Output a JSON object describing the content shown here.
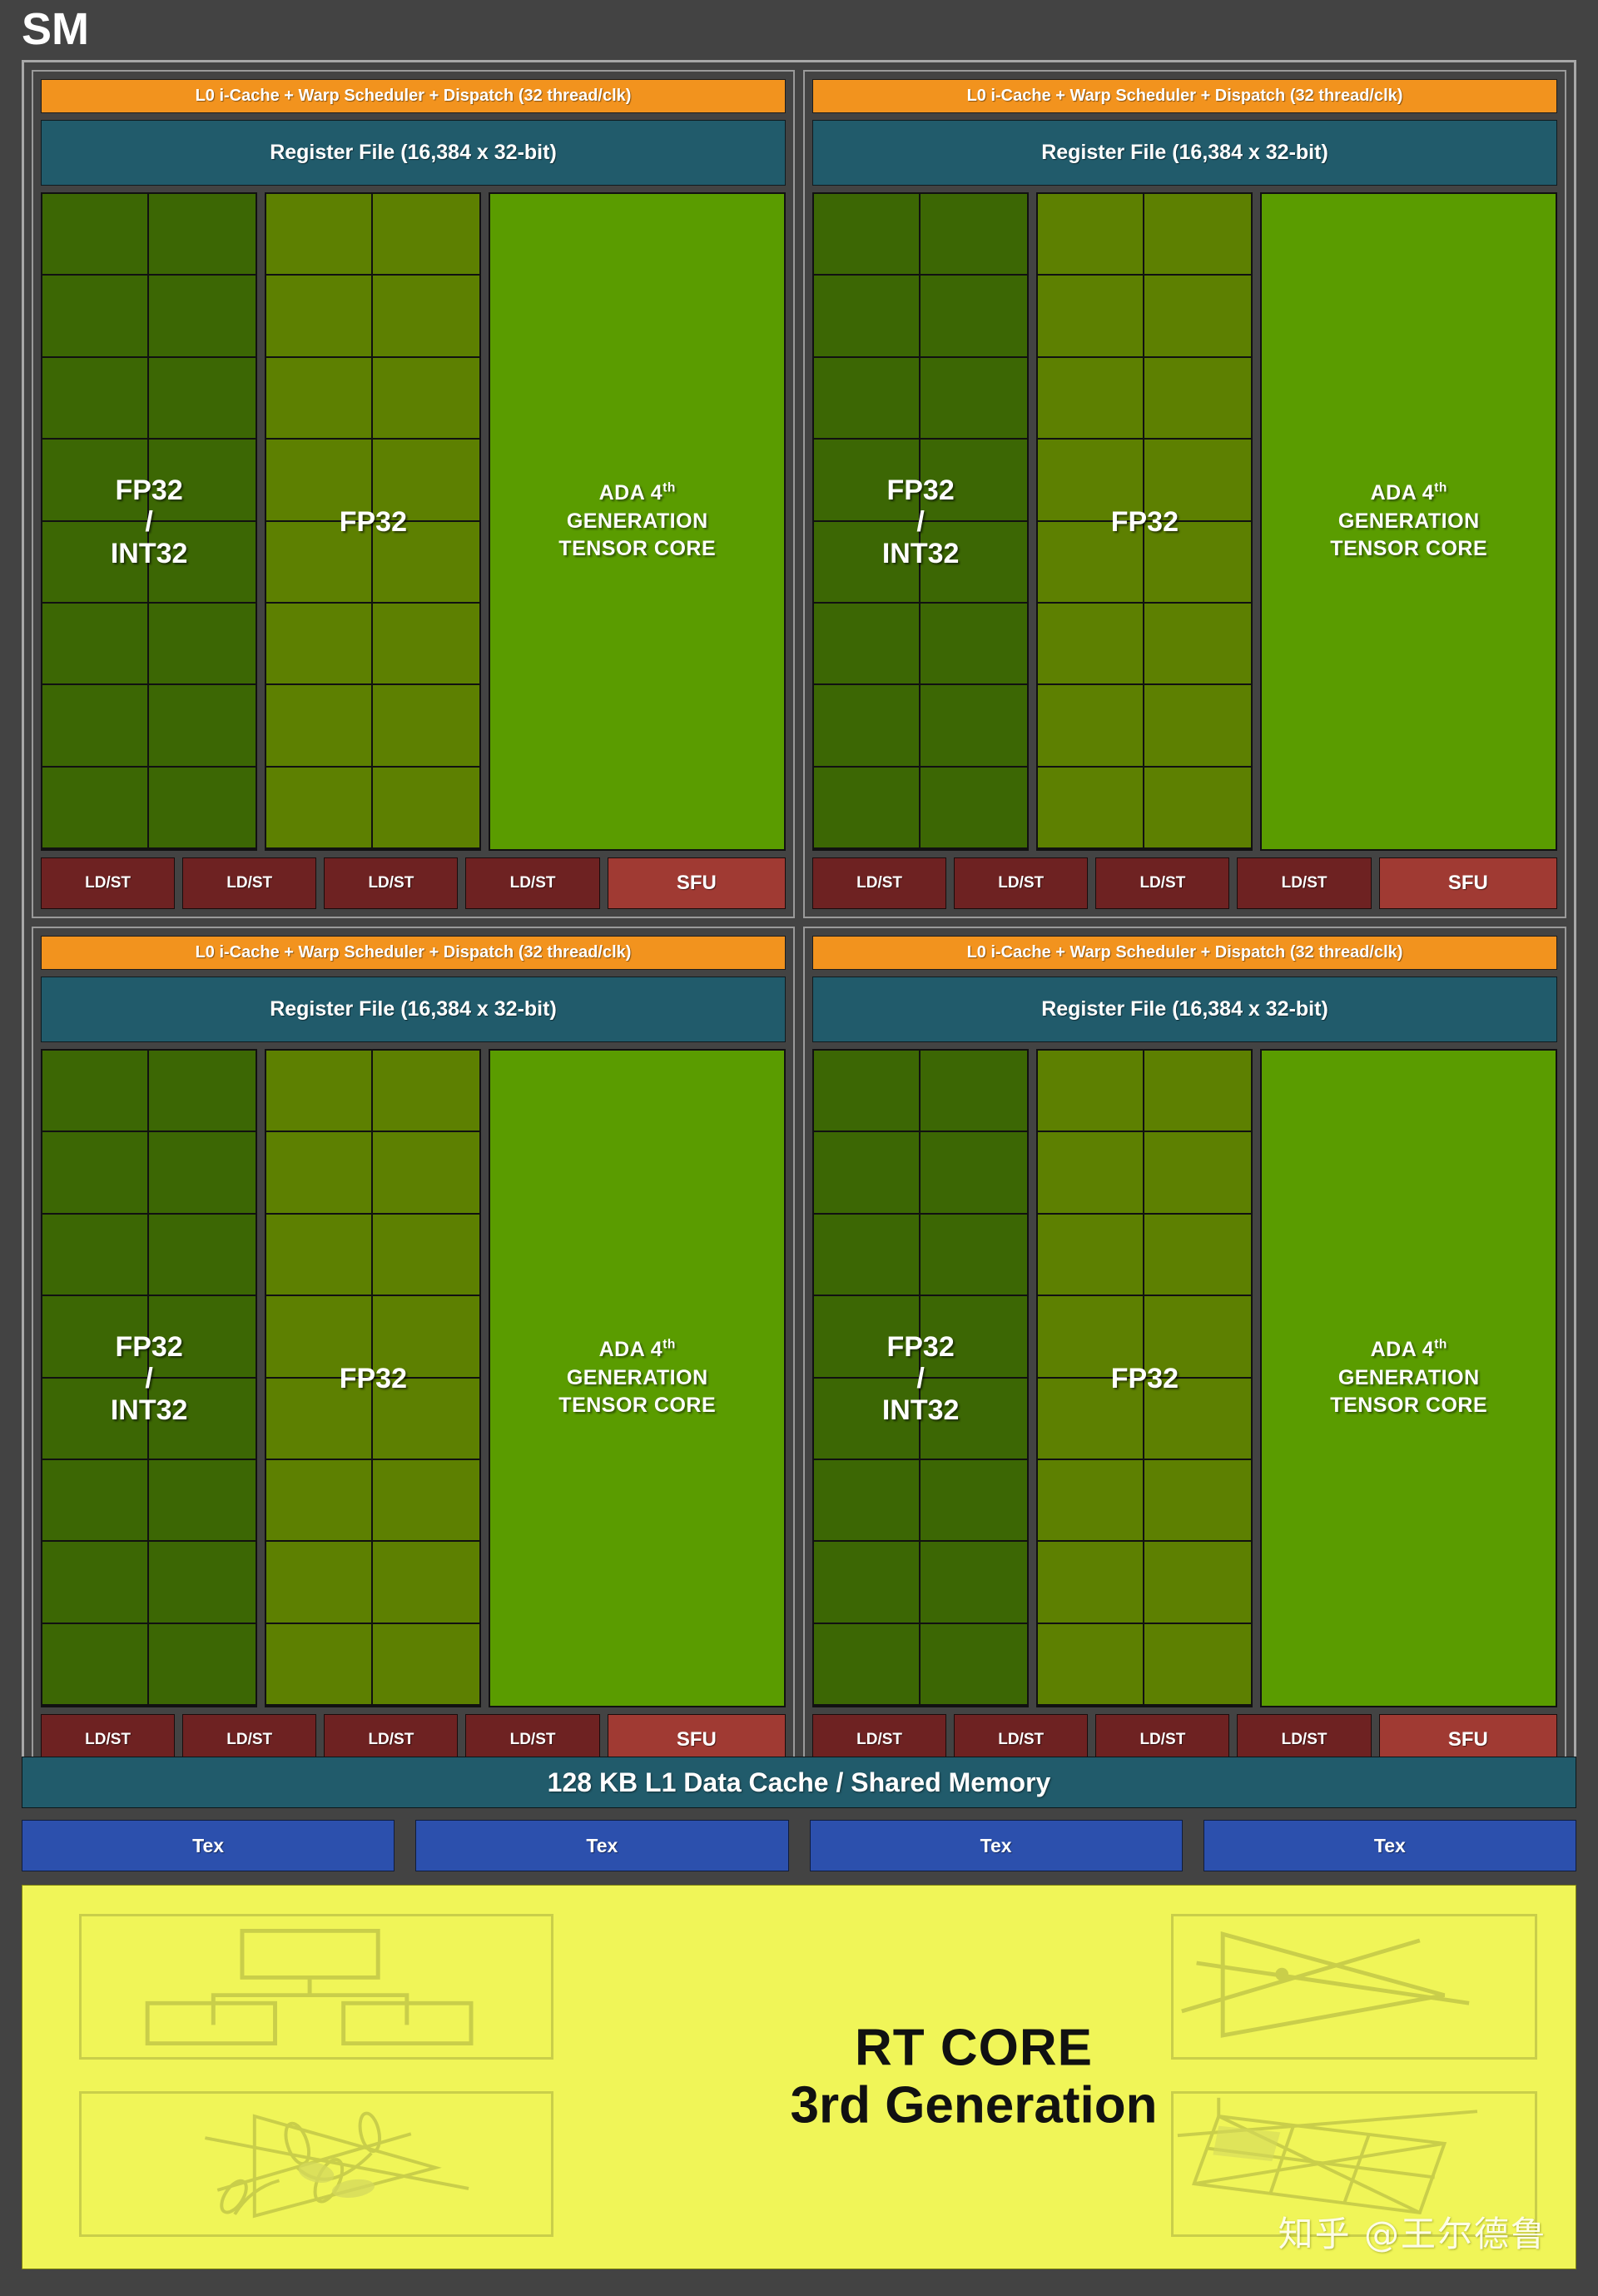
{
  "title": "SM",
  "processing_blocks": [
    {
      "warp_scheduler": "L0 i-Cache + Warp Scheduler + Dispatch (32 thread/clk)",
      "register_file": "Register File (16,384 x 32-bit)",
      "core_groups": [
        {
          "label": "FP32\n/\nINT32",
          "cells": 16,
          "color": "#3c6704"
        },
        {
          "label": "FP32",
          "cells": 16,
          "color": "#5d8001"
        }
      ],
      "tensor_core": {
        "line1": "ADA 4",
        "sup": "th",
        "line2": "GENERATION",
        "line3": "TENSOR CORE",
        "color": "#5a9c00"
      },
      "ldst": [
        "LD/ST",
        "LD/ST",
        "LD/ST",
        "LD/ST"
      ],
      "sfu": "SFU"
    },
    {
      "warp_scheduler": "L0 i-Cache + Warp Scheduler + Dispatch (32 thread/clk)",
      "register_file": "Register File (16,384 x 32-bit)",
      "core_groups": [
        {
          "label": "FP32\n/\nINT32",
          "cells": 16,
          "color": "#3c6704"
        },
        {
          "label": "FP32",
          "cells": 16,
          "color": "#5d8001"
        }
      ],
      "tensor_core": {
        "line1": "ADA 4",
        "sup": "th",
        "line2": "GENERATION",
        "line3": "TENSOR CORE",
        "color": "#5a9c00"
      },
      "ldst": [
        "LD/ST",
        "LD/ST",
        "LD/ST",
        "LD/ST"
      ],
      "sfu": "SFU"
    },
    {
      "warp_scheduler": "L0 i-Cache + Warp Scheduler + Dispatch (32 thread/clk)",
      "register_file": "Register File (16,384 x 32-bit)",
      "core_groups": [
        {
          "label": "FP32\n/\nINT32",
          "cells": 16,
          "color": "#3c6704"
        },
        {
          "label": "FP32",
          "cells": 16,
          "color": "#5d8001"
        }
      ],
      "tensor_core": {
        "line1": "ADA 4",
        "sup": "th",
        "line2": "GENERATION",
        "line3": "TENSOR CORE",
        "color": "#5a9c00"
      },
      "ldst": [
        "LD/ST",
        "LD/ST",
        "LD/ST",
        "LD/ST"
      ],
      "sfu": "SFU"
    },
    {
      "warp_scheduler": "L0 i-Cache + Warp Scheduler + Dispatch (32 thread/clk)",
      "register_file": "Register File (16,384 x 32-bit)",
      "core_groups": [
        {
          "label": "FP32\n/\nINT32",
          "cells": 16,
          "color": "#3c6704"
        },
        {
          "label": "FP32",
          "cells": 16,
          "color": "#5d8001"
        }
      ],
      "tensor_core": {
        "line1": "ADA 4",
        "sup": "th",
        "line2": "GENERATION",
        "line3": "TENSOR CORE",
        "color": "#5a9c00"
      },
      "ldst": [
        "LD/ST",
        "LD/ST",
        "LD/ST",
        "LD/ST"
      ],
      "sfu": "SFU"
    }
  ],
  "l1_cache": "128 KB L1 Data Cache / Shared Memory",
  "tex_units": [
    "Tex",
    "Tex",
    "Tex",
    "Tex"
  ],
  "rt_core": {
    "line1": "RT CORE",
    "line2": "3rd Generation",
    "background": "#f0f558",
    "illustrations": [
      "bvh-tree-icon",
      "foliage-triangle-icon",
      "ray-triangle-icon",
      "mesh-grid-icon"
    ]
  },
  "watermark": "知乎 @王尔德鲁",
  "colors": {
    "background": "#434343",
    "warp_scheduler": "#f2931e",
    "register_file": "#215b6b",
    "fp32_int32": "#3c6704",
    "fp32": "#5d8001",
    "tensor_core": "#5a9c00",
    "ldst": "#6e2222",
    "sfu": "#a03a33",
    "l1_cache": "#215b6b",
    "tex": "#2c50ad",
    "rt_core": "#f0f558"
  }
}
